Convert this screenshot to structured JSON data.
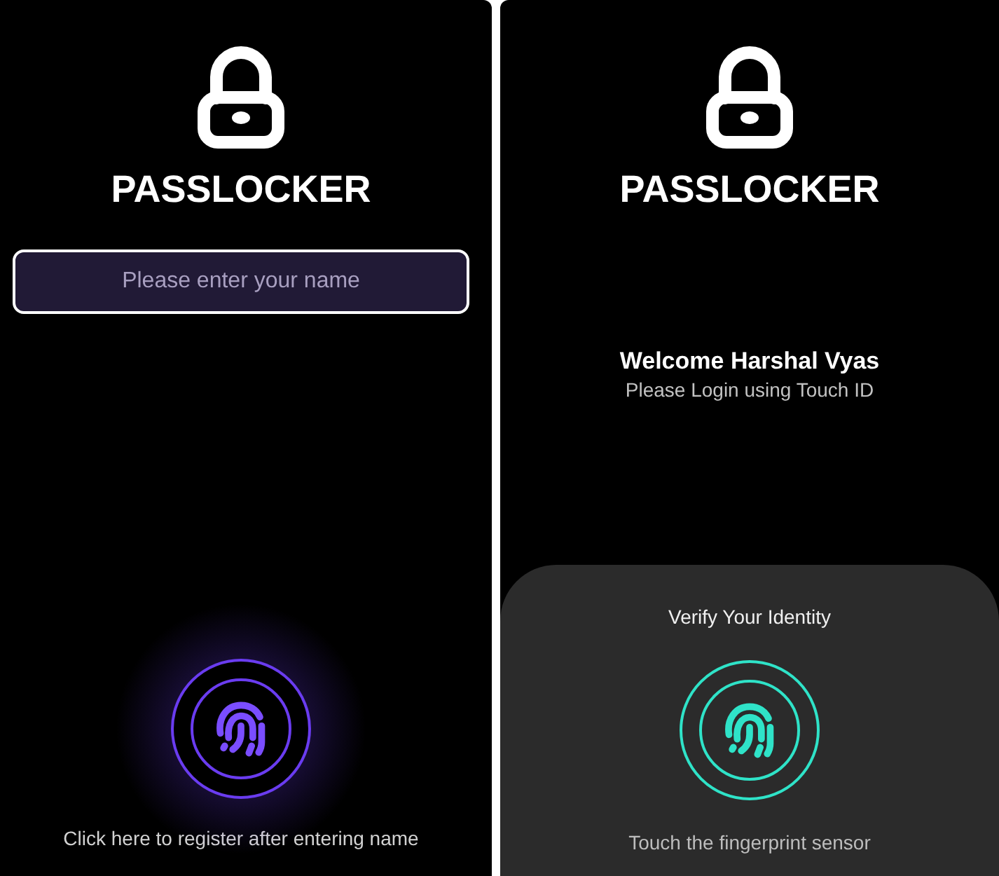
{
  "screens": [
    {
      "kind": "register",
      "app_title": "PASSLOCKER",
      "name_field": {
        "placeholder": "Please enter your name"
      },
      "hint": "Click here to register after entering name"
    },
    {
      "kind": "login",
      "app_title": "PASSLOCKER",
      "welcome": "Welcome Harshal Vyas",
      "subtitle": "Please Login using Touch ID",
      "sheet": {
        "title": "Verify Your Identity",
        "hint": "Touch the fingerprint sensor"
      }
    }
  ]
}
